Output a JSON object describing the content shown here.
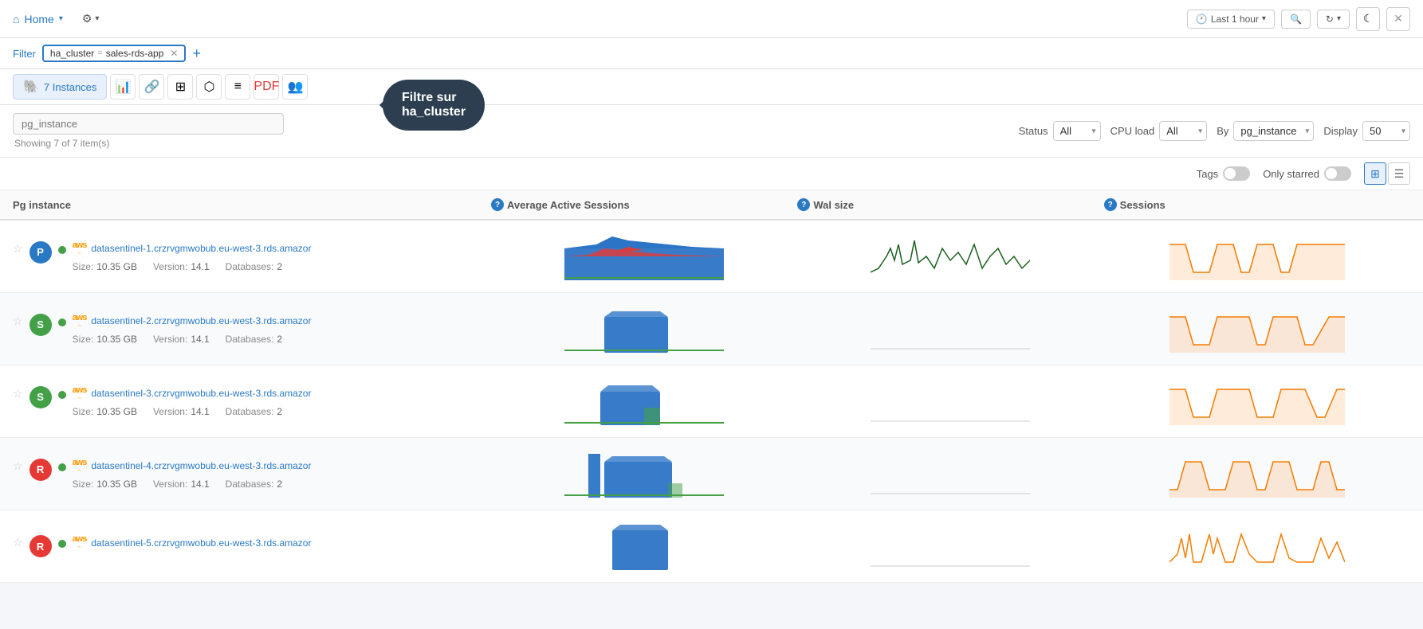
{
  "topnav": {
    "home_label": "Home",
    "gear_label": "Settings",
    "last_hour_label": "Last 1 hour",
    "search_icon": "🔍",
    "refresh_icon": "↻",
    "moon_icon": "☾",
    "close_icon": "✕"
  },
  "filter_bar": {
    "filter_label": "Filter",
    "tag1": "ha_cluster",
    "separator": "=",
    "tag2": "sales-rds-app",
    "add_label": "+",
    "tooltip": "Filtre sur\nha_cluster"
  },
  "view_toolbar": {
    "instances_count": "7 Instances"
  },
  "controls": {
    "search_placeholder": "pg_instance",
    "showing_text": "Showing 7 of 7 item(s)",
    "status_label": "Status",
    "status_value": "All",
    "cpu_load_label": "CPU load",
    "cpu_load_value": "All",
    "by_label": "By",
    "by_value": "pg_instance",
    "display_label": "Display",
    "display_value": "50"
  },
  "tags_row": {
    "tags_label": "Tags",
    "only_starred_label": "Only starred"
  },
  "table_headers": {
    "pg_instance": "Pg instance",
    "avg_active_sessions": "Average Active Sessions",
    "wal_size": "Wal size",
    "sessions": "Sessions"
  },
  "instances": [
    {
      "id": 1,
      "role": "P",
      "status": "online",
      "hostname": "datasentinel-1.crzrvgmwobub.eu-west-3.rds.amazor",
      "size": "10.35 GB",
      "version": "14.1",
      "databases": "2",
      "chart_avg": "blue_red",
      "chart_wal": "dark_green",
      "chart_sessions": "orange"
    },
    {
      "id": 2,
      "role": "S",
      "status": "online",
      "hostname": "datasentinel-2.crzrvgmwobub.eu-west-3.rds.amazor",
      "size": "10.35 GB",
      "version": "14.1",
      "databases": "2",
      "chart_avg": "blue_small",
      "chart_wal": "none",
      "chart_sessions": "orange"
    },
    {
      "id": 3,
      "role": "S",
      "status": "online",
      "hostname": "datasentinel-3.crzrvgmwobub.eu-west-3.rds.amazor",
      "size": "10.35 GB",
      "version": "14.1",
      "databases": "2",
      "chart_avg": "blue_small",
      "chart_wal": "none",
      "chart_sessions": "orange"
    },
    {
      "id": 4,
      "role": "R",
      "status": "online",
      "hostname": "datasentinel-4.crzrvgmwobub.eu-west-3.rds.amazor",
      "size": "10.35 GB",
      "version": "14.1",
      "databases": "2",
      "chart_avg": "blue_medium",
      "chart_wal": "none",
      "chart_sessions": "orange"
    },
    {
      "id": 5,
      "role": "R",
      "status": "online",
      "hostname": "datasentinel-5.crzrvgmwobub.eu-west-3.rds.amazor",
      "size": "",
      "version": "",
      "databases": "",
      "chart_avg": "blue_tall",
      "chart_wal": "none",
      "chart_sessions": "orange_spiky"
    }
  ],
  "colors": {
    "accent": "#2979c5",
    "green": "#43a047",
    "red": "#e53935",
    "orange": "#f57c00"
  }
}
